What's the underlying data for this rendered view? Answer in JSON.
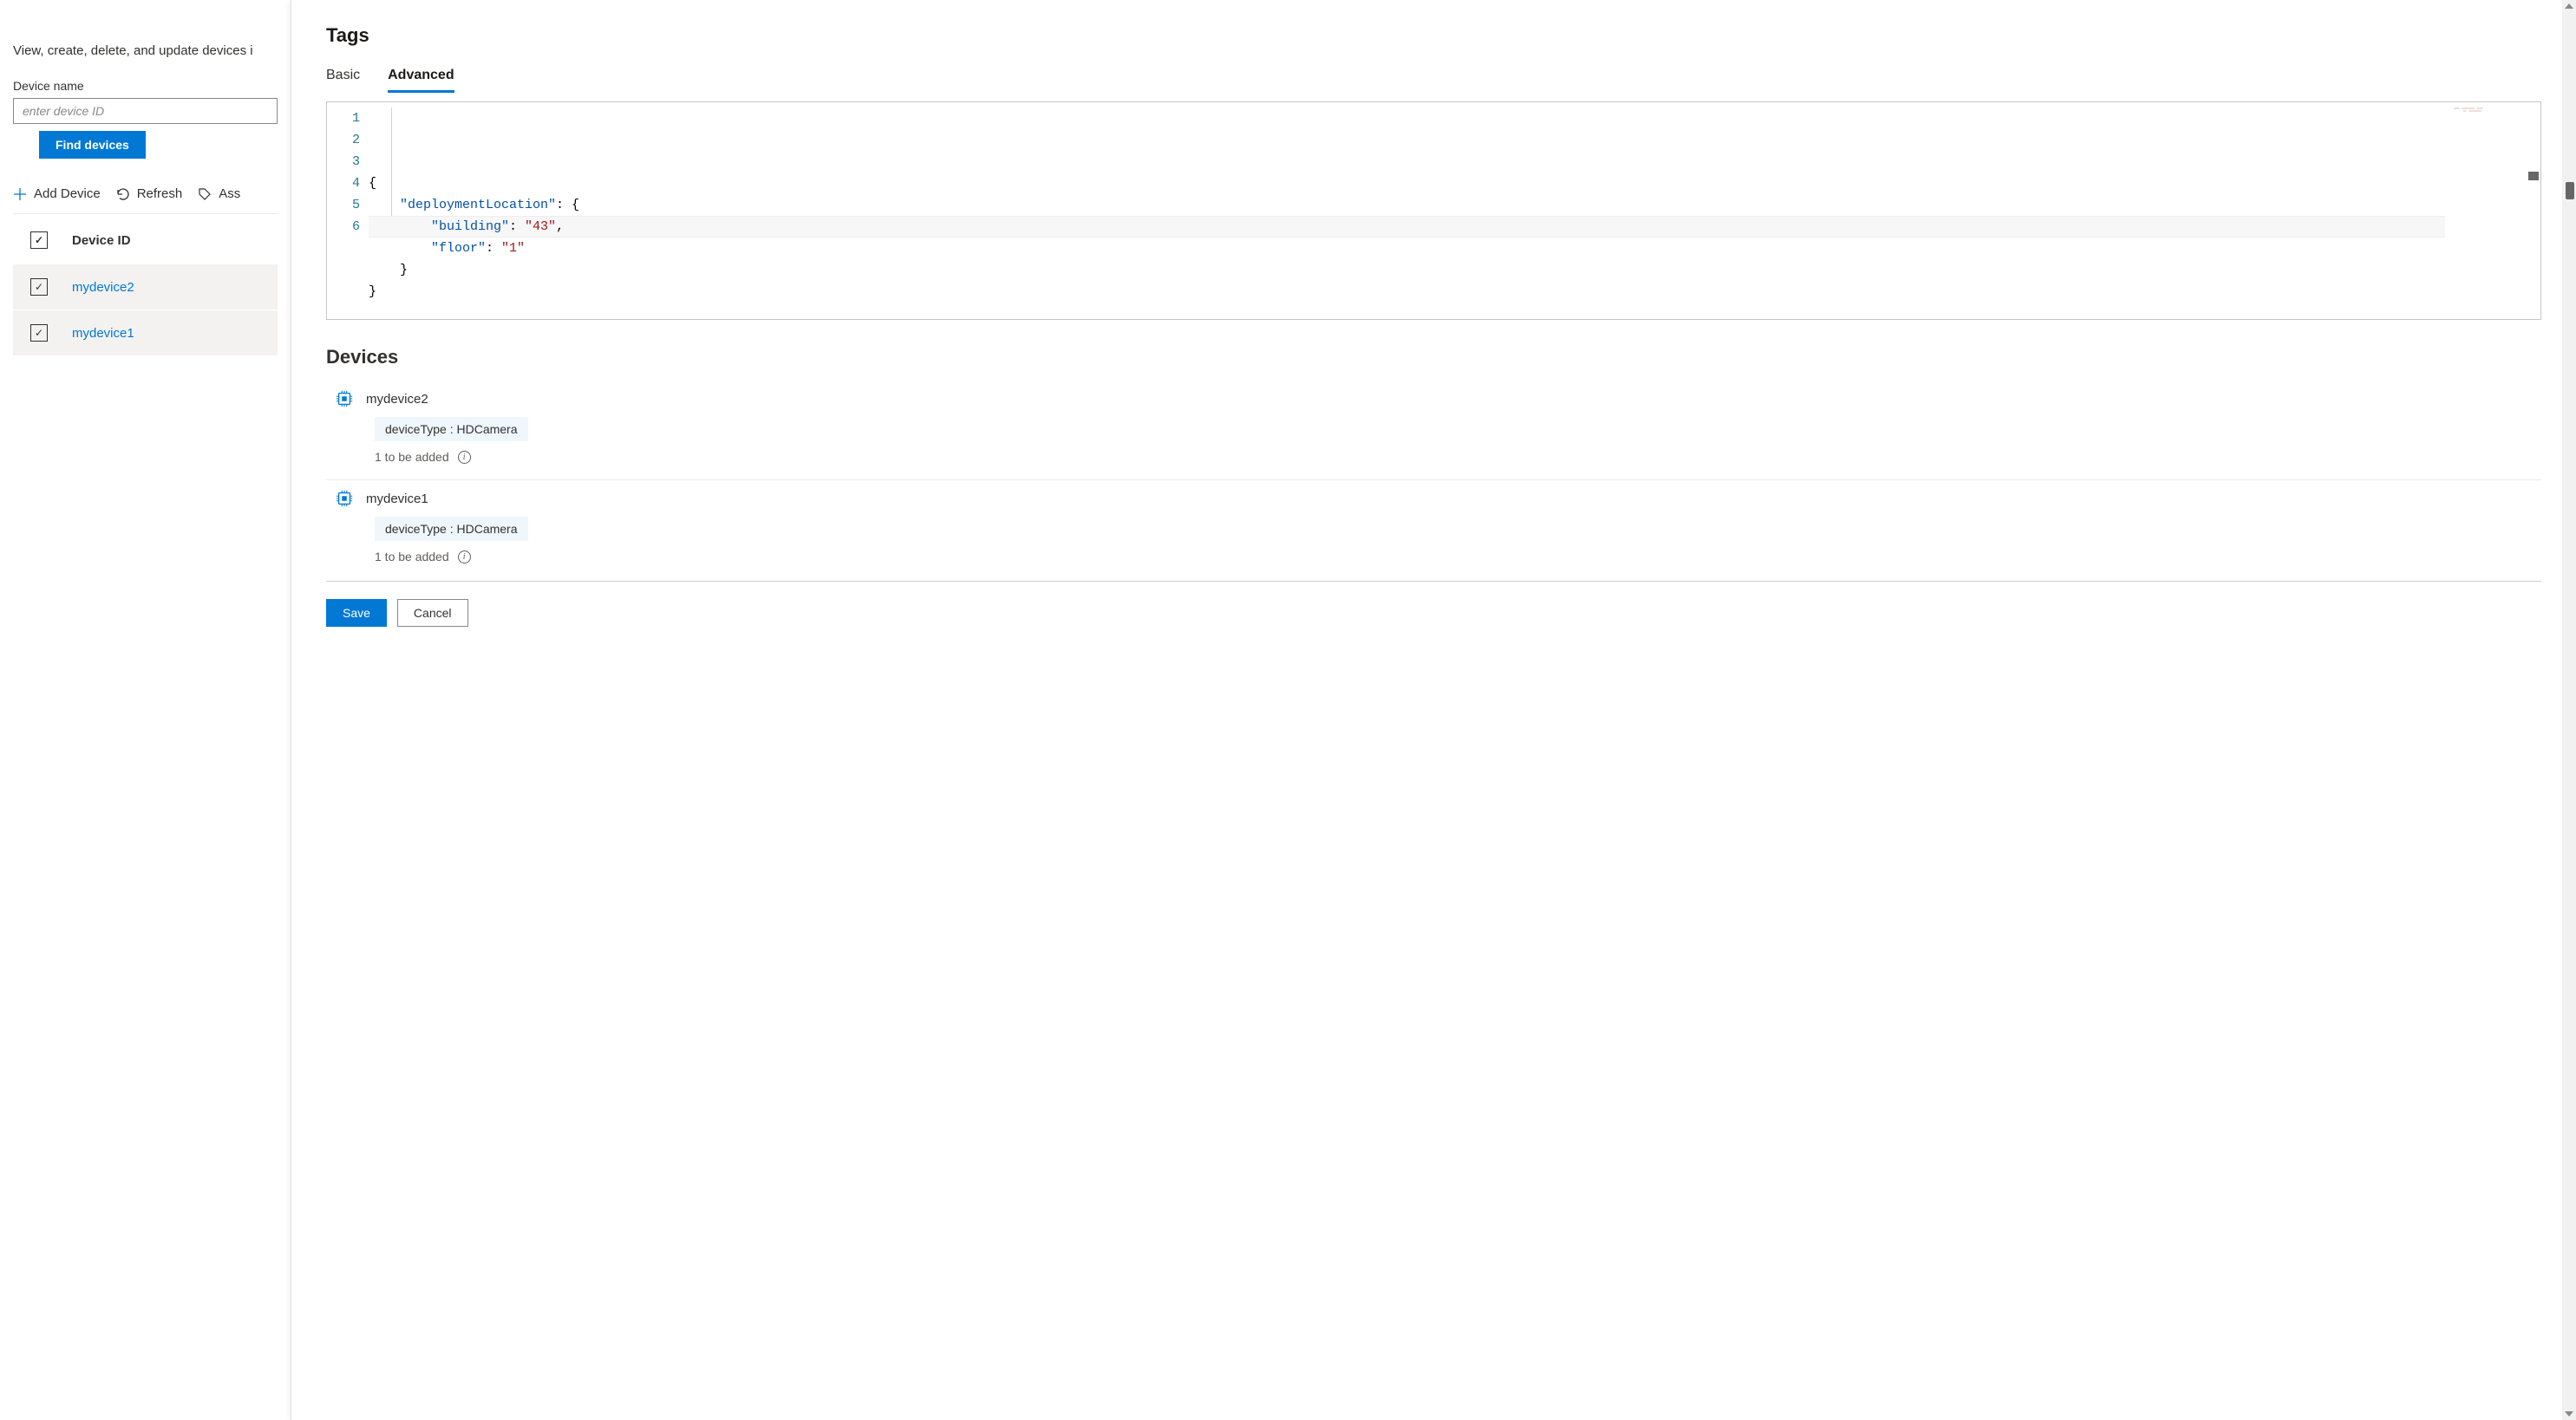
{
  "left": {
    "intro": "View, create, delete, and update devices i",
    "field_label": "Device name",
    "input_placeholder": "enter device ID",
    "find_button": "Find devices",
    "toolbar": {
      "add": "Add Device",
      "refresh": "Refresh",
      "assign": "Ass"
    },
    "table": {
      "header": "Device ID",
      "rows": [
        {
          "id": "mydevice2"
        },
        {
          "id": "mydevice1"
        }
      ]
    }
  },
  "right": {
    "title": "Tags",
    "tabs": {
      "basic": "Basic",
      "advanced": "Advanced"
    },
    "code": {
      "lines": [
        "1",
        "2",
        "3",
        "4",
        "5",
        "6"
      ],
      "json": {
        "deploymentLocation": {
          "building": "43",
          "floor": "1"
        }
      },
      "tokens": {
        "l1": "{",
        "l2_key": "\"deploymentLocation\"",
        "l2_after": ": {",
        "l3_key": "\"building\"",
        "l3_colon": ": ",
        "l3_val": "\"43\"",
        "l3_comma": ",",
        "l4_key": "\"floor\"",
        "l4_colon": ": ",
        "l4_val": "\"1\"",
        "l5": "}",
        "l6": "}"
      }
    },
    "devices": {
      "title": "Devices",
      "items": [
        {
          "name": "mydevice2",
          "tag": "deviceType : HDCamera",
          "add": "1 to be added"
        },
        {
          "name": "mydevice1",
          "tag": "deviceType : HDCamera",
          "add": "1 to be added"
        }
      ]
    },
    "footer": {
      "save": "Save",
      "cancel": "Cancel"
    }
  }
}
